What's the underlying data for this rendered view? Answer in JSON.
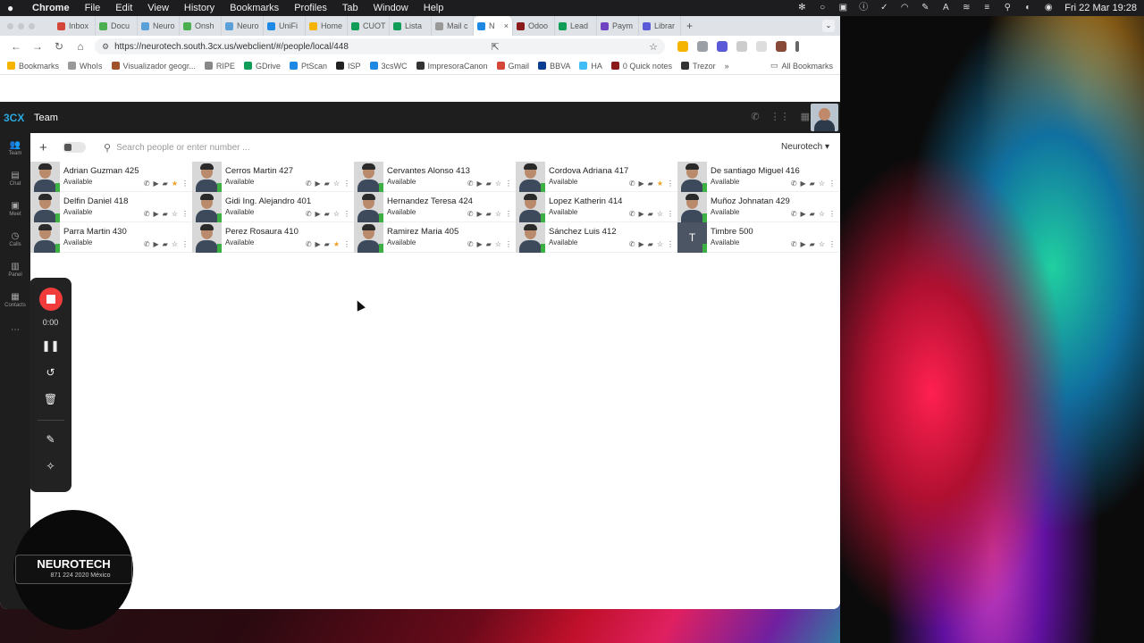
{
  "menubar": {
    "app": "Chrome",
    "items": [
      "File",
      "Edit",
      "View",
      "History",
      "Bookmarks",
      "Profiles",
      "Tab",
      "Window",
      "Help"
    ],
    "clock": "Fri 22 Mar  19:28"
  },
  "tabs": [
    {
      "label": "Inbox",
      "color": "#d44638"
    },
    {
      "label": "Docu",
      "color": "#4caf50"
    },
    {
      "label": "Neuro",
      "color": "#5aa0d8"
    },
    {
      "label": "Onsh",
      "color": "#4caf50"
    },
    {
      "label": "Neuro",
      "color": "#5aa0d8"
    },
    {
      "label": "UniFi",
      "color": "#1e88e5"
    },
    {
      "label": "Home",
      "color": "#f4b400"
    },
    {
      "label": "CUOT",
      "color": "#0f9d58"
    },
    {
      "label": "Lista",
      "color": "#0f9d58"
    },
    {
      "label": "Mail c",
      "color": "#999999"
    },
    {
      "label": "N",
      "color": "#1e88e5",
      "active": true
    },
    {
      "label": "Odoo",
      "color": "#8b1a1a"
    },
    {
      "label": "Lead",
      "color": "#0f9d58"
    },
    {
      "label": "Paym",
      "color": "#6f42c1"
    },
    {
      "label": "Librar",
      "color": "#5a5ad8"
    }
  ],
  "address": {
    "url": "https://neurotech.south.3cx.us/webclient/#/people/local/448"
  },
  "bookmarks": [
    {
      "label": "Bookmarks",
      "color": "#f4b400"
    },
    {
      "label": "WhoIs",
      "color": "#999999"
    },
    {
      "label": "Visualizador geogr...",
      "color": "#a0522d"
    },
    {
      "label": "RIPE",
      "color": "#888888"
    },
    {
      "label": "GDrive",
      "color": "#0f9d58"
    },
    {
      "label": "PtScan",
      "color": "#1e88e5"
    },
    {
      "label": "ISP",
      "color": "#222222"
    },
    {
      "label": "3csWC",
      "color": "#1e88e5"
    },
    {
      "label": "ImpresoraCanon",
      "color": "#333333"
    },
    {
      "label": "Gmail",
      "color": "#d44638"
    },
    {
      "label": "BBVA",
      "color": "#0a3d91"
    },
    {
      "label": "HA",
      "color": "#41bdf5"
    },
    {
      "label": "0 Quick notes",
      "color": "#8b1a1a"
    },
    {
      "label": "Trezor",
      "color": "#333333"
    }
  ],
  "all_bookmarks": "All Bookmarks",
  "app": {
    "logo": "3CX",
    "title": "Team",
    "search_placeholder": "Search people or enter number ...",
    "group": "Neurotech",
    "sidebar": [
      {
        "label": "Team",
        "icon": "team-icon"
      },
      {
        "label": "Chat",
        "icon": "chat-icon"
      },
      {
        "label": "Meet",
        "icon": "meet-icon"
      },
      {
        "label": "Calls",
        "icon": "calls-icon"
      },
      {
        "label": "Panel",
        "icon": "panel-icon"
      },
      {
        "label": "Contacts",
        "icon": "contacts-icon"
      },
      {
        "label": "...",
        "icon": "more-icon"
      }
    ],
    "status_text": "Available",
    "people": [
      {
        "name": "Adrian Guzman 425",
        "fav": true
      },
      {
        "name": "Cerros Martin 427",
        "fav": false
      },
      {
        "name": "Cervantes Alonso 413",
        "fav": false
      },
      {
        "name": "Cordova Adriana 417",
        "fav": true
      },
      {
        "name": "De santiago Miguel 416",
        "fav": false
      },
      {
        "name": "Delfin Daniel 418",
        "fav": false
      },
      {
        "name": "Gidi Ing. Alejandro 401",
        "fav": false
      },
      {
        "name": "Hernandez Teresa 424",
        "fav": false
      },
      {
        "name": "Lopez Katherin 414",
        "fav": false
      },
      {
        "name": "Muñoz Johnatan 429",
        "fav": false
      },
      {
        "name": "Parra Martin 430",
        "fav": false
      },
      {
        "name": "Perez Rosaura 410",
        "fav": true
      },
      {
        "name": "Ramirez Maria 405",
        "fav": false
      },
      {
        "name": "Sánchez Luis 412",
        "fav": false
      },
      {
        "name": "Timbre 500",
        "fav": false,
        "letter": "T"
      }
    ]
  },
  "recorder": {
    "timer": "0:00"
  },
  "overlay": {
    "brand": "NEUROTECH",
    "sub": "871 224 2020   México"
  }
}
